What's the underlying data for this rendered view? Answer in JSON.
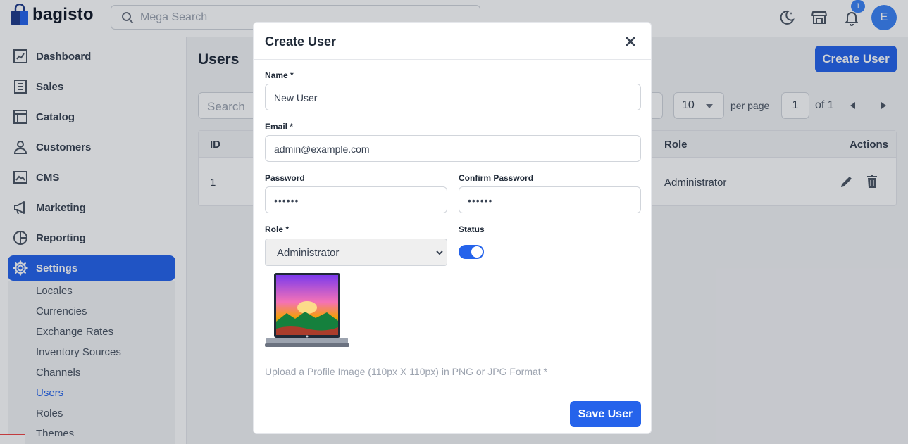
{
  "header": {
    "brand": "bagisto",
    "search_placeholder": "Mega Search",
    "notification_count": "1",
    "avatar_initial": "E"
  },
  "sidebar": {
    "items": [
      {
        "label": "Dashboard",
        "icon": "dashboard-icon"
      },
      {
        "label": "Sales",
        "icon": "sales-icon"
      },
      {
        "label": "Catalog",
        "icon": "catalog-icon"
      },
      {
        "label": "Customers",
        "icon": "customers-icon"
      },
      {
        "label": "CMS",
        "icon": "cms-icon"
      },
      {
        "label": "Marketing",
        "icon": "marketing-icon"
      },
      {
        "label": "Reporting",
        "icon": "reporting-icon"
      },
      {
        "label": "Settings",
        "icon": "settings-icon",
        "active": true
      }
    ],
    "settings_children": [
      "Locales",
      "Currencies",
      "Exchange Rates",
      "Inventory Sources",
      "Channels",
      "Users",
      "Roles",
      "Themes"
    ],
    "active_child": "Users"
  },
  "main": {
    "title": "Users",
    "create_button": "Create User",
    "search_placeholder": "Search",
    "per_page_value": "10",
    "per_page_label": "per page",
    "current_page": "1",
    "of_label": "of 1",
    "table": {
      "headers": {
        "id": "ID",
        "role": "Role",
        "actions": "Actions"
      },
      "rows": [
        {
          "id": "1",
          "role": "Administrator"
        }
      ]
    }
  },
  "modal": {
    "title": "Create User",
    "name_label": "Name *",
    "name_value": "New User",
    "email_label": "Email *",
    "email_value": "admin@example.com",
    "password_label": "Password",
    "password_value": "••••••",
    "confirm_password_label": "Confirm Password",
    "confirm_password_value": "••••••",
    "role_label": "Role *",
    "role_value": "Administrator",
    "status_label": "Status",
    "status_enabled": true,
    "upload_hint": "Upload a Profile Image (110px X 110px) in PNG or JPG Format *",
    "save_button": "Save User"
  },
  "colors": {
    "accent": "#2563eb",
    "badge": "#3b82f6"
  }
}
